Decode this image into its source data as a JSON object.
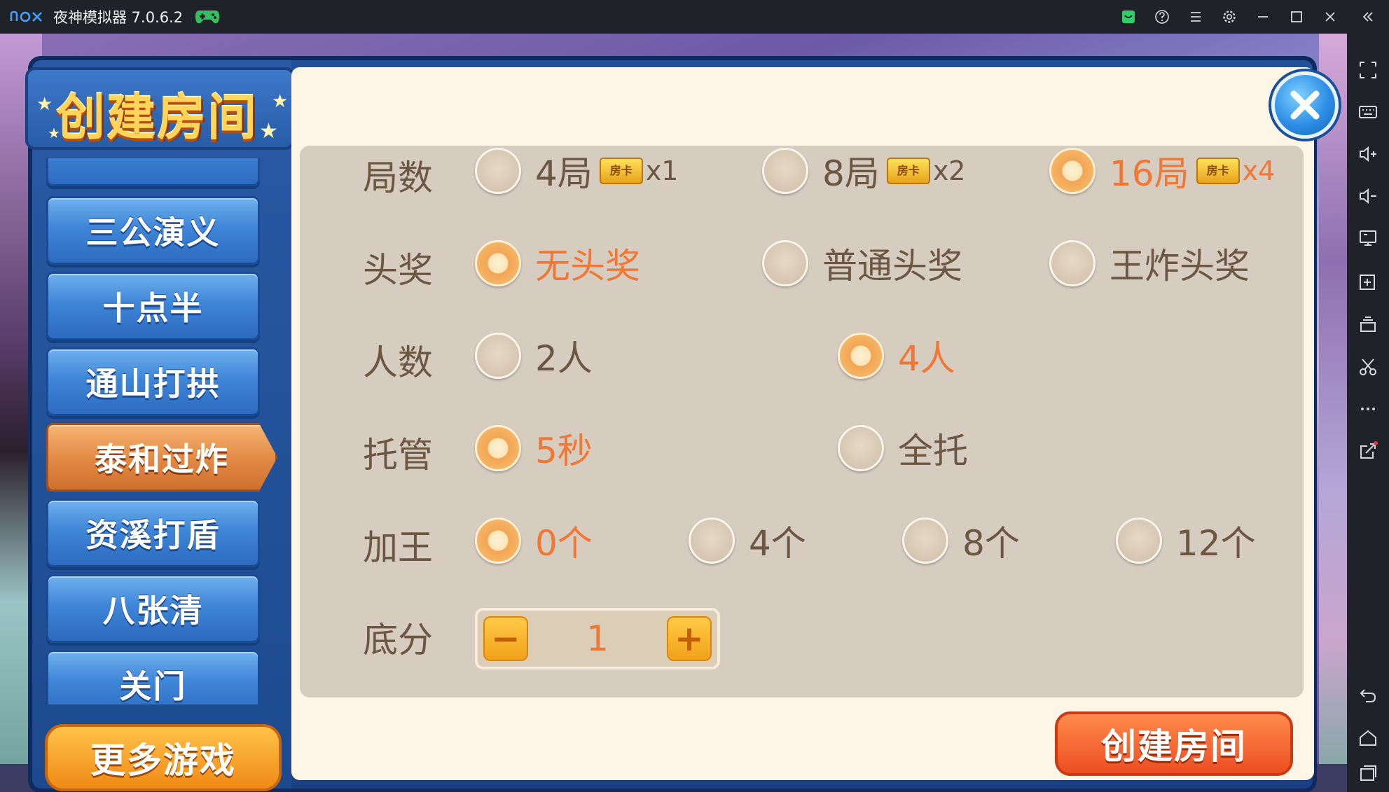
{
  "window": {
    "app_title": "夜神模拟器 7.0.6.2",
    "logo": "nox"
  },
  "dialog": {
    "title": "创建房间",
    "games": [
      {
        "label": "三公演义"
      },
      {
        "label": "十点半"
      },
      {
        "label": "通山打拱"
      },
      {
        "label": "泰和过炸"
      },
      {
        "label": "资溪打盾"
      },
      {
        "label": "八张清"
      },
      {
        "label": "关门"
      }
    ],
    "more_games_label": "更多游戏",
    "create_label": "创建房间",
    "rows": {
      "rounds": {
        "label": "局数",
        "options": [
          {
            "text": "4局",
            "card": "房卡",
            "mult": "x1",
            "selected": false
          },
          {
            "text": "8局",
            "card": "房卡",
            "mult": "x2",
            "selected": false
          },
          {
            "text": "16局",
            "card": "房卡",
            "mult": "x4",
            "selected": true
          }
        ]
      },
      "jackpot": {
        "label": "头奖",
        "options": [
          {
            "text": "无头奖",
            "selected": true
          },
          {
            "text": "普通头奖",
            "selected": false
          },
          {
            "text": "王炸头奖",
            "selected": false
          }
        ]
      },
      "players": {
        "label": "人数",
        "options": [
          {
            "text": "2人",
            "selected": false
          },
          {
            "text": "4人",
            "selected": true
          }
        ]
      },
      "autoplay": {
        "label": "托管",
        "options": [
          {
            "text": "5秒",
            "selected": true
          },
          {
            "text": "全托",
            "selected": false
          }
        ]
      },
      "jokers": {
        "label": "加王",
        "options": [
          {
            "text": "0个",
            "selected": true
          },
          {
            "text": "4个",
            "selected": false
          },
          {
            "text": "8个",
            "selected": false
          },
          {
            "text": "12个",
            "selected": false
          }
        ]
      },
      "base_score": {
        "label": "底分",
        "value": "1",
        "minus": "−",
        "plus": "+"
      }
    }
  },
  "colors": {
    "selected_text": "#f07734",
    "normal_text": "#6c5745",
    "panel_bg": "#d7ccc0",
    "content_bg": "#fdf6e6",
    "accent_orange": "#ec4e22"
  }
}
